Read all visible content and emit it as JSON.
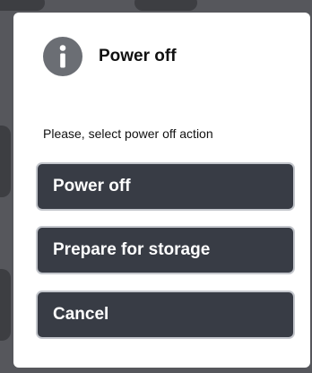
{
  "dialog": {
    "title": "Power off",
    "icon": "info-icon",
    "prompt": "Please, select power off action",
    "buttons": {
      "power_off": "Power off",
      "prepare_storage": "Prepare for storage",
      "cancel": "Cancel"
    }
  },
  "colors": {
    "button_bg": "#383c45",
    "button_border": "#c3c6cc",
    "icon_bg": "#6b6e74"
  }
}
